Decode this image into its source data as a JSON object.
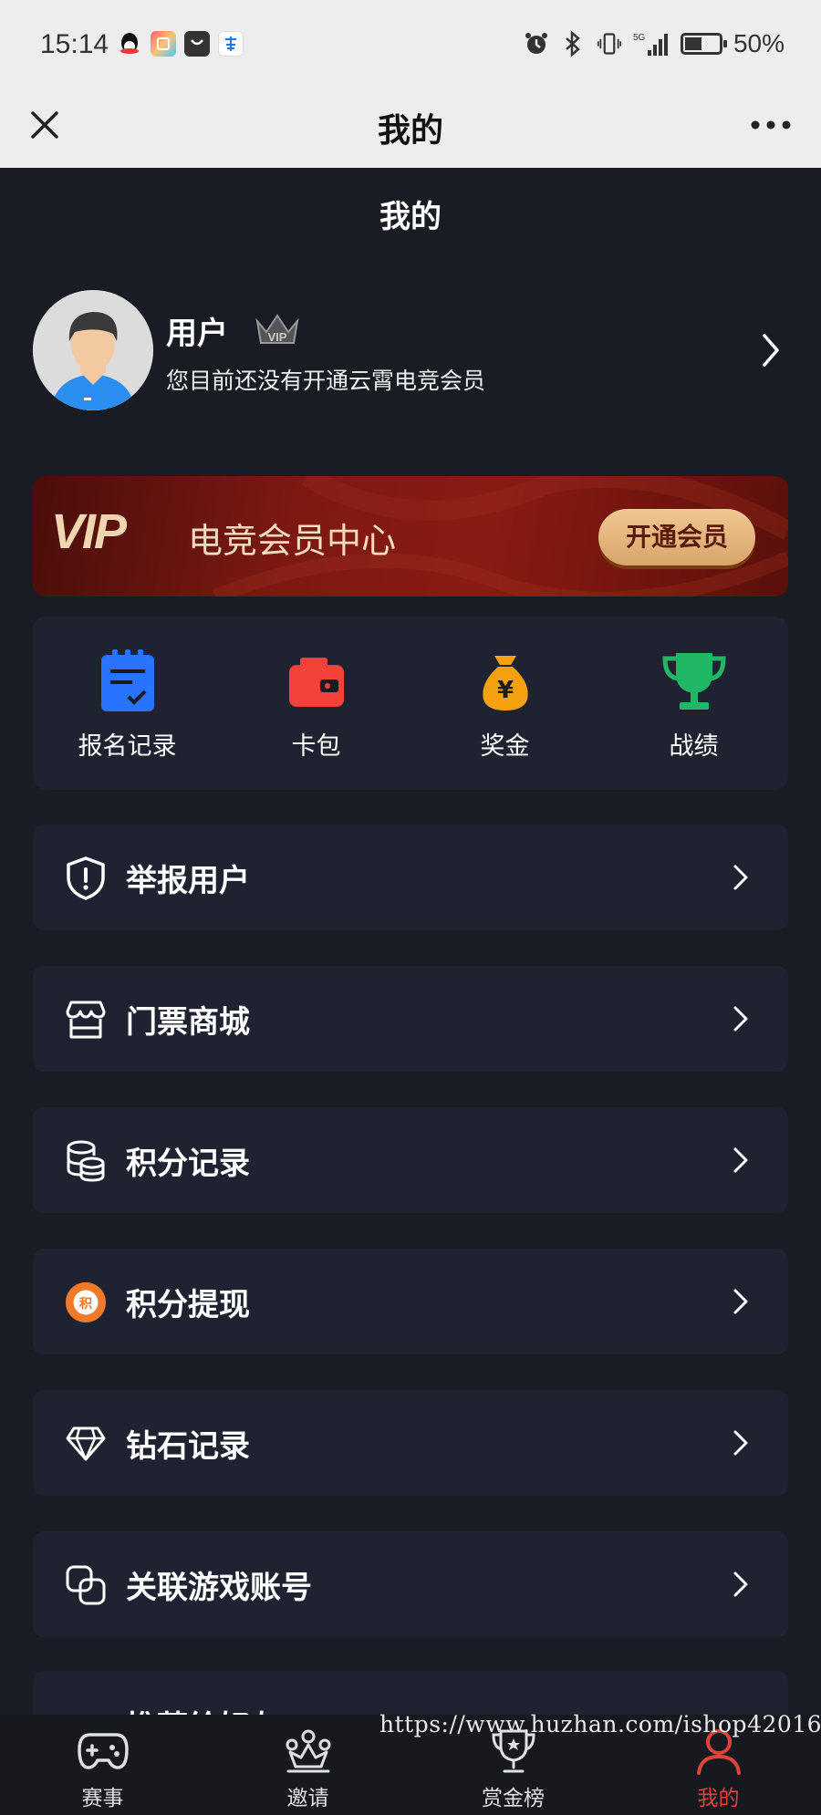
{
  "status_bar": {
    "time": "15:14",
    "battery": "50%",
    "network": "5G",
    "battery_level": 0.5,
    "app_icons": [
      "qq-icon",
      "photos-icon",
      "taobao-icon",
      "alipay-icon"
    ]
  },
  "nav": {
    "title": "我的"
  },
  "page": {
    "header": "我的"
  },
  "profile": {
    "username": "用户",
    "vip_badge": "VIP",
    "subtitle": "您目前还没有开通云霄电竞会员"
  },
  "vip_banner": {
    "vip_word": "VIP",
    "title": "电竞会员中心",
    "button_label": "开通会员"
  },
  "quick_actions": [
    {
      "label": "报名记录",
      "icon": "clipboard-icon",
      "color": "#2a73ff"
    },
    {
      "label": "卡包",
      "icon": "wallet-icon",
      "color": "#f2423a"
    },
    {
      "label": "奖金",
      "icon": "money-bag-icon",
      "color": "#f5a10f"
    },
    {
      "label": "战绩",
      "icon": "trophy-icon",
      "color": "#1fb665"
    }
  ],
  "menu": [
    {
      "label": "举报用户",
      "icon": "shield-alert-icon"
    },
    {
      "label": "门票商城",
      "icon": "store-icon"
    },
    {
      "label": "积分记录",
      "icon": "coins-stack-icon"
    },
    {
      "label": "积分提现",
      "icon": "points-badge-icon"
    },
    {
      "label": "钻石记录",
      "icon": "diamond-icon"
    },
    {
      "label": "关联游戏账号",
      "icon": "link-icon"
    }
  ],
  "partial_item": {
    "label": "推荐给好友"
  },
  "tab_bar": [
    {
      "label": "赛事",
      "icon": "gamepad-icon",
      "active": false
    },
    {
      "label": "邀请",
      "icon": "invite-icon",
      "active": false
    },
    {
      "label": "赏金榜",
      "icon": "trophy-outline-icon",
      "active": false
    },
    {
      "label": "我的",
      "icon": "user-icon",
      "active": true
    }
  ],
  "colors": {
    "background": "#1a1c24",
    "card": "#1f2230",
    "accent": "#e0433a",
    "vip_gold": "#efd5b0"
  },
  "watermark": "https://www.huzhan.com/ishop42016"
}
